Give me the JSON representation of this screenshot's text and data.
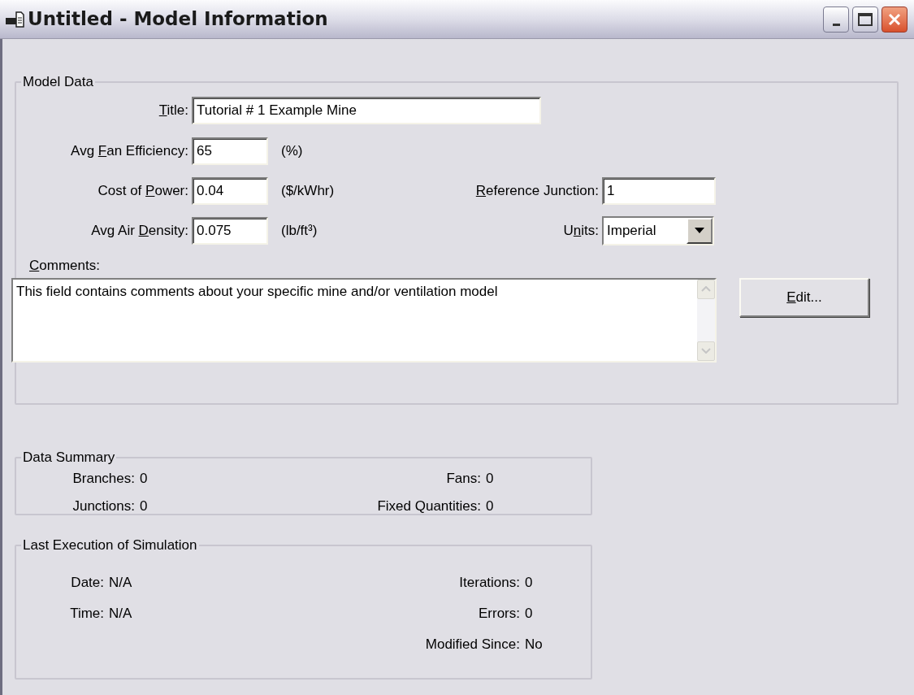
{
  "window": {
    "title": "Untitled - Model Information"
  },
  "model_data": {
    "legend": "Model Data",
    "title_field": {
      "label": [
        {
          "text": "T",
          "underline": true
        },
        {
          "text": "itle:",
          "underline": false
        }
      ],
      "value": "Tutorial # 1 Example Mine"
    },
    "fan_efficiency": {
      "label": [
        {
          "text": "Avg ",
          "underline": false
        },
        {
          "text": "F",
          "underline": true
        },
        {
          "text": "an Efficiency:",
          "underline": false
        }
      ],
      "value": "65",
      "unit": "(%)"
    },
    "cost_of_power": {
      "label": [
        {
          "text": "Cost of ",
          "underline": false
        },
        {
          "text": "P",
          "underline": true
        },
        {
          "text": "ower:",
          "underline": false
        }
      ],
      "value": "0.04",
      "unit": "($/kWhr)"
    },
    "reference_junction": {
      "label": [
        {
          "text": "R",
          "underline": true
        },
        {
          "text": "eference Junction:",
          "underline": false
        }
      ],
      "value": "1"
    },
    "air_density": {
      "label": [
        {
          "text": "Avg Air ",
          "underline": false
        },
        {
          "text": "D",
          "underline": true
        },
        {
          "text": "ensity:",
          "underline": false
        }
      ],
      "value": "0.075",
      "unit": "(lb/ft³)"
    },
    "units": {
      "label": [
        {
          "text": "U",
          "underline": false
        },
        {
          "text": "n",
          "underline": true
        },
        {
          "text": "its:",
          "underline": false
        }
      ],
      "value": "Imperial"
    },
    "comments": {
      "label": [
        {
          "text": "C",
          "underline": true
        },
        {
          "text": "omments:",
          "underline": false
        }
      ],
      "value": "This field contains comments about your specific mine and/or ventilation model"
    },
    "edit_button": [
      {
        "text": "E",
        "underline": true
      },
      {
        "text": "dit...",
        "underline": false
      }
    ]
  },
  "data_summary": {
    "legend": "Data Summary",
    "rows": [
      {
        "left": {
          "label": "Branches:",
          "value": "0"
        },
        "right": {
          "label": "Fans:",
          "value": "0"
        }
      },
      {
        "left": {
          "label": "Junctions:",
          "value": "0"
        },
        "right": {
          "label": "Fixed Quantities:",
          "value": "0"
        }
      }
    ]
  },
  "last_execution": {
    "legend": "Last Execution of Simulation",
    "rows": [
      {
        "left": {
          "label": "Date:",
          "value": "N/A"
        },
        "right": {
          "label": "Iterations:",
          "value": "0"
        }
      },
      {
        "left": {
          "label": "Time:",
          "value": "N/A"
        },
        "right": {
          "label": "Errors:",
          "value": "0"
        }
      },
      {
        "right": {
          "label": "Modified Since:",
          "value": "No"
        }
      }
    ]
  }
}
